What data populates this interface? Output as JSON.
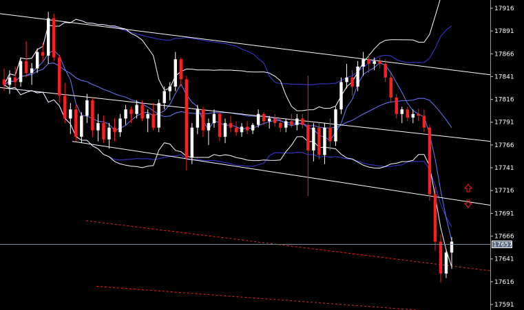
{
  "chart_data": {
    "type": "candlestick",
    "ylim": [
      17585,
      17925
    ],
    "y_ticks": [
      "17916",
      "17891",
      "17866",
      "17841",
      "17816",
      "17791",
      "17766",
      "17741",
      "17716",
      "17691",
      "17666",
      "17641",
      "17616",
      "17591"
    ],
    "current_price": "17657",
    "colors": {
      "background": "#000000",
      "bull_body": "#ffffff",
      "bear_body": "#ff1e1e",
      "channel": "#ffffff",
      "bands": "#ffffff",
      "moving_average_slow": "#3a3adf",
      "moving_average_fast": "#6a7cff",
      "dashed_lines": "#ff2020",
      "price_line": "#7a8ea8",
      "arrows": "#ff2020"
    },
    "candles_ohlc": [
      [
        17838,
        17850,
        17825,
        17832
      ],
      [
        17832,
        17848,
        17822,
        17840
      ],
      [
        17840,
        17852,
        17830,
        17835
      ],
      [
        17835,
        17862,
        17830,
        17858
      ],
      [
        17858,
        17880,
        17840,
        17845
      ],
      [
        17845,
        17856,
        17832,
        17850
      ],
      [
        17850,
        17872,
        17845,
        17868
      ],
      [
        17868,
        17878,
        17858,
        17864
      ],
      [
        17864,
        17912,
        17855,
        17905
      ],
      [
        17905,
        17910,
        17858,
        17862
      ],
      [
        17862,
        17865,
        17812,
        17820
      ],
      [
        17820,
        17834,
        17790,
        17795
      ],
      [
        17795,
        17812,
        17778,
        17805
      ],
      [
        17805,
        17810,
        17770,
        17775
      ],
      [
        17775,
        17802,
        17768,
        17798
      ],
      [
        17798,
        17822,
        17790,
        17815
      ],
      [
        17815,
        17818,
        17775,
        17782
      ],
      [
        17782,
        17800,
        17770,
        17790
      ],
      [
        17790,
        17798,
        17768,
        17772
      ],
      [
        17772,
        17790,
        17762,
        17785
      ],
      [
        17785,
        17795,
        17770,
        17780
      ],
      [
        17780,
        17800,
        17775,
        17795
      ],
      [
        17795,
        17810,
        17788,
        17805
      ],
      [
        17805,
        17808,
        17790,
        17800
      ],
      [
        17800,
        17815,
        17795,
        17810
      ],
      [
        17810,
        17815,
        17792,
        17795
      ],
      [
        17795,
        17805,
        17780,
        17800
      ],
      [
        17800,
        17812,
        17782,
        17785
      ],
      [
        17785,
        17816,
        17780,
        17812
      ],
      [
        17812,
        17830,
        17805,
        17825
      ],
      [
        17825,
        17835,
        17815,
        17830
      ],
      [
        17830,
        17868,
        17825,
        17860
      ],
      [
        17860,
        17862,
        17830,
        17838
      ],
      [
        17838,
        17842,
        17738,
        17752
      ],
      [
        17752,
        17790,
        17745,
        17785
      ],
      [
        17785,
        17810,
        17778,
        17805
      ],
      [
        17805,
        17808,
        17775,
        17782
      ],
      [
        17782,
        17795,
        17766,
        17790
      ],
      [
        17790,
        17805,
        17785,
        17800
      ],
      [
        17800,
        17802,
        17770,
        17775
      ],
      [
        17775,
        17795,
        17768,
        17790
      ],
      [
        17790,
        17798,
        17780,
        17785
      ],
      [
        17785,
        17792,
        17776,
        17780
      ],
      [
        17780,
        17790,
        17775,
        17786
      ],
      [
        17786,
        17792,
        17778,
        17782
      ],
      [
        17782,
        17790,
        17778,
        17788
      ],
      [
        17788,
        17805,
        17785,
        17800
      ],
      [
        17800,
        17802,
        17788,
        17792
      ],
      [
        17792,
        17798,
        17784,
        17795
      ],
      [
        17795,
        17800,
        17786,
        17790
      ],
      [
        17790,
        17796,
        17780,
        17785
      ],
      [
        17785,
        17795,
        17780,
        17792
      ],
      [
        17792,
        17800,
        17785,
        17788
      ],
      [
        17788,
        17800,
        17782,
        17795
      ],
      [
        17795,
        17800,
        17784,
        17788
      ],
      [
        17788,
        17842,
        17710,
        17760
      ],
      [
        17760,
        17790,
        17748,
        17785
      ],
      [
        17785,
        17790,
        17750,
        17755
      ],
      [
        17755,
        17790,
        17745,
        17785
      ],
      [
        17785,
        17795,
        17760,
        17770
      ],
      [
        17770,
        17808,
        17765,
        17805
      ],
      [
        17805,
        17840,
        17800,
        17835
      ],
      [
        17835,
        17855,
        17828,
        17840
      ],
      [
        17840,
        17848,
        17820,
        17830
      ],
      [
        17830,
        17858,
        17825,
        17852
      ],
      [
        17852,
        17868,
        17842,
        17860
      ],
      [
        17860,
        17866,
        17845,
        17855
      ],
      [
        17855,
        17862,
        17848,
        17858
      ],
      [
        17858,
        17862,
        17850,
        17855
      ],
      [
        17855,
        17860,
        17835,
        17840
      ],
      [
        17840,
        17845,
        17812,
        17818
      ],
      [
        17818,
        17822,
        17795,
        17800
      ],
      [
        17800,
        17808,
        17790,
        17805
      ],
      [
        17805,
        17808,
        17792,
        17796
      ],
      [
        17796,
        17805,
        17790,
        17800
      ],
      [
        17800,
        17806,
        17792,
        17798
      ],
      [
        17798,
        17805,
        17780,
        17785
      ],
      [
        17785,
        17788,
        17705,
        17712
      ],
      [
        17712,
        17720,
        17650,
        17660
      ],
      [
        17660,
        17668,
        17615,
        17625
      ],
      [
        17625,
        17652,
        17620,
        17648
      ],
      [
        17648,
        17665,
        17630,
        17660
      ]
    ]
  }
}
